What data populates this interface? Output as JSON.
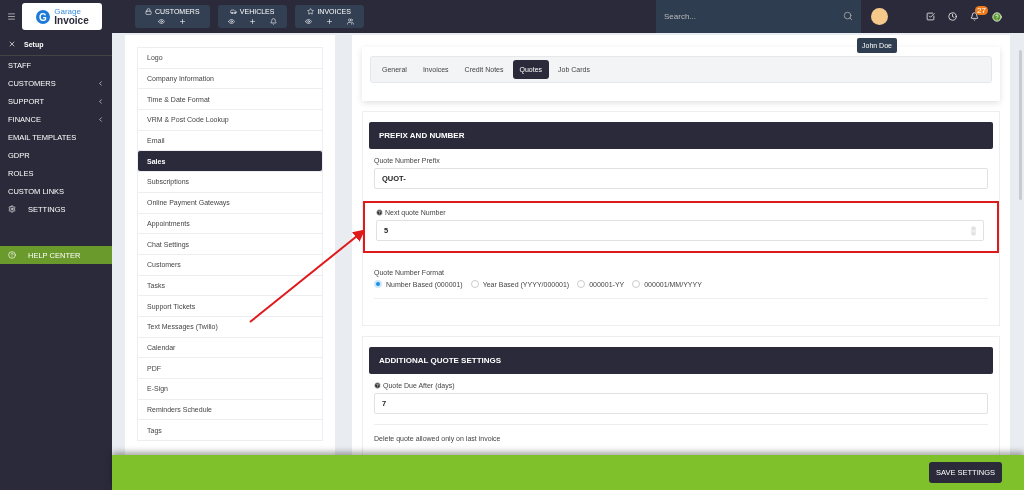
{
  "topbar": {
    "logo": {
      "mark": "G",
      "line1": "Garage",
      "line2": "Invoice"
    },
    "groups": [
      {
        "label": "CUSTOMERS"
      },
      {
        "label": "VEHICLES"
      },
      {
        "label": "INVOICES"
      }
    ],
    "search": {
      "placeholder": "Search..."
    },
    "notification_count": "27",
    "user_tooltip": "John Doe"
  },
  "sidebar": {
    "header": "Setup",
    "items": [
      {
        "label": "STAFF",
        "expandable": false
      },
      {
        "label": "CUSTOMERS",
        "expandable": true
      },
      {
        "label": "SUPPORT",
        "expandable": true
      },
      {
        "label": "FINANCE",
        "expandable": true
      },
      {
        "label": "EMAIL TEMPLATES",
        "expandable": false
      },
      {
        "label": "GDPR",
        "expandable": false
      },
      {
        "label": "ROLES",
        "expandable": false
      },
      {
        "label": "CUSTOM LINKS",
        "expandable": false
      }
    ],
    "settings_link": "SETTINGS",
    "help_link": "HELP CENTER"
  },
  "settings_menu": [
    {
      "label": "Logo",
      "selected": false
    },
    {
      "label": "Company Information",
      "selected": false
    },
    {
      "label": "Time & Date Format",
      "selected": false
    },
    {
      "label": "VRM & Post Code Lookup",
      "selected": false
    },
    {
      "label": "Email",
      "selected": false
    },
    {
      "label": "Sales",
      "selected": true
    },
    {
      "label": "Subscriptions",
      "selected": false
    },
    {
      "label": "Online Payment Gateways",
      "selected": false
    },
    {
      "label": "Appointments",
      "selected": false
    },
    {
      "label": "Chat Settings",
      "selected": false
    },
    {
      "label": "Customers",
      "selected": false
    },
    {
      "label": "Tasks",
      "selected": false
    },
    {
      "label": "Support Tickets",
      "selected": false
    },
    {
      "label": "Text Messages (Twilio)",
      "selected": false
    },
    {
      "label": "Calendar",
      "selected": false
    },
    {
      "label": "PDF",
      "selected": false
    },
    {
      "label": "E-Sign",
      "selected": false
    },
    {
      "label": "Reminders Schedule",
      "selected": false
    },
    {
      "label": "Tags",
      "selected": false
    }
  ],
  "tabs": [
    {
      "label": "General",
      "selected": false
    },
    {
      "label": "Invoices",
      "selected": false
    },
    {
      "label": "Credit Notes",
      "selected": false
    },
    {
      "label": "Quotes",
      "selected": true
    },
    {
      "label": "Job Cards",
      "selected": false
    }
  ],
  "sections": [
    {
      "title": "PREFIX AND NUMBER",
      "fields": [
        {
          "kind": "text",
          "label": "Quote Number Prefix",
          "value": "QUOT-",
          "help": false,
          "highlighted": false,
          "spinner": false
        },
        {
          "kind": "text",
          "label": "Next quote Number",
          "value": "5",
          "help": true,
          "highlighted": true,
          "spinner": true
        },
        {
          "kind": "radio",
          "label": "Quote Number Format",
          "options": [
            {
              "label": "Number Based (000001)",
              "selected": true
            },
            {
              "label": "Year Based (YYYY/000001)",
              "selected": false
            },
            {
              "label": "000001-YY",
              "selected": false
            },
            {
              "label": "000001/MM/YYYY",
              "selected": false
            }
          ]
        }
      ]
    },
    {
      "title": "ADDITIONAL QUOTE SETTINGS",
      "fields": [
        {
          "kind": "text",
          "label": "Quote Due After (days)",
          "value": "7",
          "help": true,
          "highlighted": false,
          "spinner": false
        },
        {
          "kind": "note",
          "label": "Delete quote allowed only on last invoice"
        }
      ]
    }
  ],
  "footer": {
    "save_button": "SAVE SETTINGS"
  }
}
